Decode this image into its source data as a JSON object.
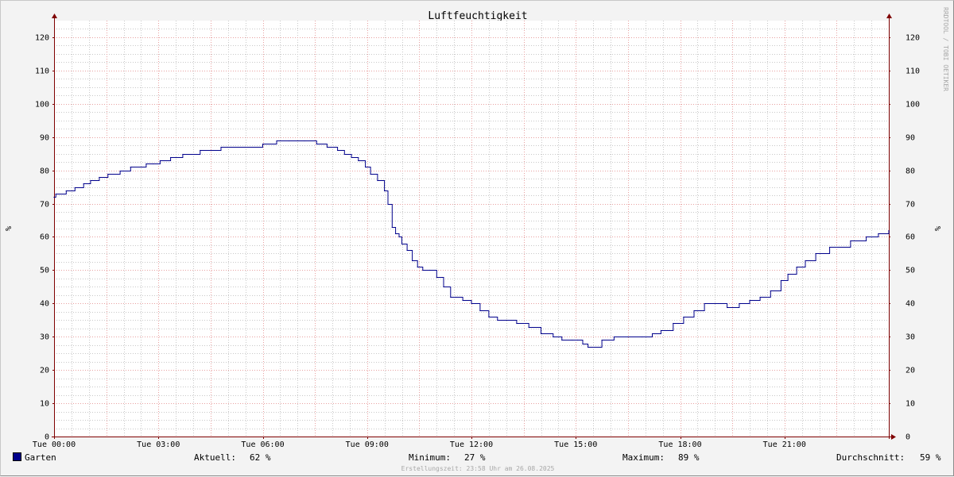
{
  "chart_data": {
    "type": "line",
    "title": "Luftfeuchtigkeit",
    "ylabel": "%",
    "ylabel_right": "%",
    "ylim": [
      0,
      125
    ],
    "yticks": [
      0,
      10,
      20,
      30,
      40,
      50,
      60,
      70,
      80,
      90,
      100,
      110,
      120
    ],
    "xlim": [
      0,
      24
    ],
    "xtick_hours": [
      0,
      3,
      6,
      9,
      12,
      15,
      18,
      21
    ],
    "xtick_labels": [
      "Tue 00:00",
      "Tue 03:00",
      "Tue 06:00",
      "Tue 09:00",
      "Tue 12:00",
      "Tue 15:00",
      "Tue 18:00",
      "Tue 21:00"
    ],
    "x_unit": "hours",
    "grid": true,
    "series": [
      {
        "name": "Garten",
        "color": "#00008b",
        "x": [
          0.0,
          0.05,
          0.35,
          0.6,
          0.85,
          1.05,
          1.3,
          1.55,
          1.9,
          2.0,
          2.2,
          2.65,
          2.85,
          3.05,
          3.35,
          3.7,
          4.2,
          4.8,
          5.0,
          5.5,
          6.0,
          6.4,
          6.75,
          7.2,
          7.55,
          7.85,
          8.15,
          8.35,
          8.55,
          8.75,
          8.95,
          9.1,
          9.3,
          9.5,
          9.6,
          9.72,
          9.82,
          9.92,
          10.0,
          10.15,
          10.3,
          10.45,
          10.6,
          10.8,
          11.0,
          11.2,
          11.4,
          11.55,
          11.75,
          12.0,
          12.25,
          12.5,
          12.75,
          13.0,
          13.3,
          13.65,
          14.0,
          14.35,
          14.6,
          14.9,
          15.05,
          15.2,
          15.35,
          15.75,
          16.1,
          16.5,
          16.9,
          17.2,
          17.45,
          17.8,
          18.1,
          18.4,
          18.7,
          19.0,
          19.35,
          19.7,
          20.0,
          20.3,
          20.6,
          20.9,
          21.1,
          21.35,
          21.6,
          21.9,
          22.3,
          22.9,
          23.35,
          23.7,
          24.0
        ],
        "values": [
          72,
          73,
          74,
          75,
          76,
          77,
          78,
          79,
          80,
          80,
          81,
          82,
          82,
          83,
          84,
          85,
          86,
          87,
          87,
          87,
          88,
          89,
          89,
          89,
          88,
          87,
          86,
          85,
          84,
          83,
          81,
          79,
          77,
          74,
          70,
          63,
          61,
          60,
          58,
          56,
          53,
          51,
          50,
          50,
          48,
          45,
          42,
          42,
          41,
          40,
          38,
          36,
          35,
          35,
          34,
          33,
          31,
          30,
          29,
          29,
          29,
          28,
          27,
          29,
          30,
          30,
          30,
          31,
          32,
          34,
          36,
          38,
          40,
          40,
          39,
          40,
          41,
          42,
          44,
          47,
          49,
          51,
          53,
          55,
          57,
          59,
          60,
          61,
          62
        ]
      }
    ]
  },
  "legend": {
    "series_name": "Garten",
    "current_label": "Aktuell:",
    "current_value": "62 %",
    "min_label": "Minimum:",
    "min_value": "27 %",
    "max_label": "Maximum:",
    "max_value": "89 %",
    "avg_label": "Durchschnitt:",
    "avg_value": "59 %"
  },
  "footer": "Erstellungszeit: 23:58 Uhr am 26.08.2025",
  "vertical_label": "RRDTOOL / TOBI OETIKER",
  "colors": {
    "series": "#00008b",
    "grid_major": "#e8a0a0",
    "grid_minor": "#c8c8c8",
    "axis": "#7f0000",
    "plot_bg": "#ffffff"
  }
}
